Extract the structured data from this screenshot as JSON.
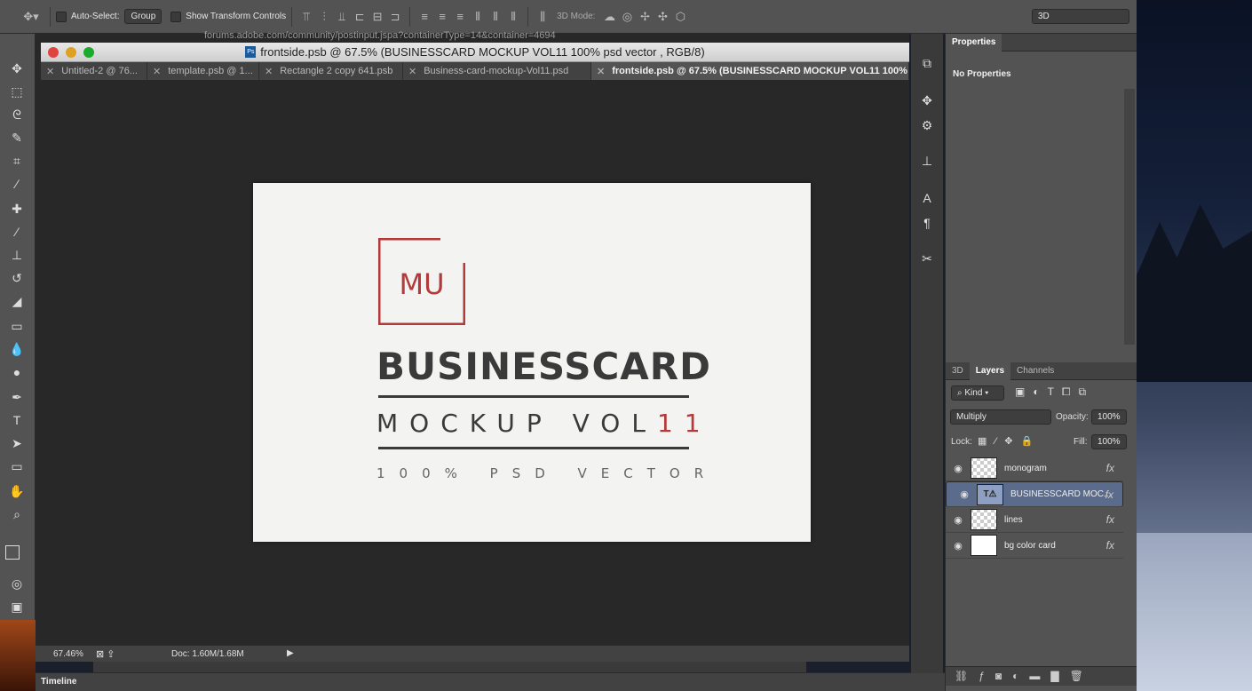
{
  "options_bar": {
    "auto_select_label": "Auto-Select:",
    "auto_select_value": "Group",
    "show_transform_label": "Show Transform Controls",
    "mode3d_label": "3D Mode:",
    "workspace": "3D"
  },
  "browser_url_fragment": "forums.adobe.com/community/postinput.jspa?containerType=14&container=4694",
  "document": {
    "title": "frontside.psb @ 67.5% (BUSINESSCARD MOCKUP VOL11 100% psd vector , RGB/8)",
    "tabs": [
      {
        "label": "Untitled-2 @ 76..."
      },
      {
        "label": "template.psb @ 1..."
      },
      {
        "label": "Rectangle 2 copy 641.psb"
      },
      {
        "label": "Business-card-mockup-Vol11.psd"
      },
      {
        "label": "frontside.psb @ 67.5% (BUSINESSCARD MOCKUP VOL11 100% psd"
      }
    ],
    "card": {
      "monogram": "MU",
      "title": "BUSINESSCARD",
      "subtitle_a": "MOCKUP VOL",
      "subtitle_b": "11",
      "tagline": "100% PSD VECTOR"
    }
  },
  "status_bar": {
    "zoom": "67.46%",
    "doc_size": "Doc: 1.60M/1.68M"
  },
  "timeline_label": "Timeline",
  "properties_panel": {
    "title": "Properties",
    "body": "No Properties"
  },
  "layers_panel": {
    "tabs": [
      "3D",
      "Layers",
      "Channels"
    ],
    "filter_kind": "Kind",
    "blend_mode": "Multiply",
    "opacity_label": "Opacity:",
    "opacity": "100%",
    "lock_label": "Lock:",
    "fill_label": "Fill:",
    "fill": "100%",
    "layers": [
      {
        "name": "monogram",
        "selected": false
      },
      {
        "name": "BUSINESSCARD MOC...",
        "selected": true
      },
      {
        "name": "lines",
        "selected": false
      },
      {
        "name": "bg color card",
        "selected": false
      }
    ]
  },
  "colors": {
    "accent_red": "#b33a3a",
    "selection_blue": "#5a6b8c"
  }
}
